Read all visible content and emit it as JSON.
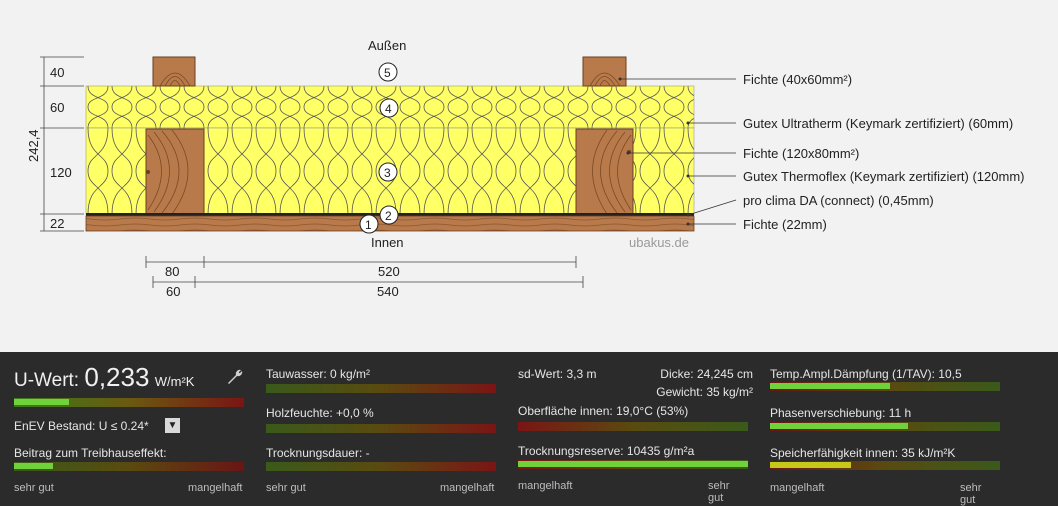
{
  "diagram": {
    "outside_label": "Außen",
    "inside_label": "Innen",
    "watermark": "ubakus.de",
    "total_thickness": "242,4",
    "left_dims": [
      "40",
      "60",
      "120",
      "22"
    ],
    "layer_numbers": [
      "5",
      "4",
      "3",
      "2",
      "1"
    ],
    "callouts": [
      "Fichte (40x60mm²)",
      "Gutex Ultratherm (Keymark zertifiziert) (60mm)",
      "Fichte (120x80mm²)",
      "Gutex Thermoflex (Keymark zertifiziert) (120mm)",
      "pro clima DA (connect) (0,45mm)",
      "Fichte (22mm)"
    ],
    "dims_top": [
      "80",
      "520"
    ],
    "dims_bottom": [
      "60",
      "540"
    ],
    "colors": {
      "insulation": "#ffff66",
      "wood": "#b87a4b",
      "membrane": "#222222"
    }
  },
  "panel": {
    "uwert": {
      "label": "U-Wert:",
      "value": "0,233",
      "unit": "W/m²K",
      "fill": 0.24,
      "icon": "wrench-icon"
    },
    "enev": {
      "label": "EnEV Bestand: U ≤ 0.24*",
      "dropdown_icon": "▼"
    },
    "treibhaus": {
      "label": "Beitrag zum Treibhauseffekt:",
      "fill": 0.17
    },
    "tauwasser": {
      "label": "Tauwasser: 0 kg/m²",
      "fill": 0.0
    },
    "holzfeuchte": {
      "label": "Holzfeuchte: +0,0 %",
      "fill": 0.0
    },
    "trocknungsdauer": {
      "label": "Trocknungsdauer: -",
      "fill": 0.0
    },
    "sdwert": {
      "label": "sd-Wert: 3,3 m"
    },
    "dicke": {
      "label": "Dicke: 24,245 cm"
    },
    "gewicht": {
      "label": "Gewicht: 35 kg/m²"
    },
    "oberflaeche": {
      "label": "Oberfläche innen: 19,0°C (53%)",
      "fill": 0.0
    },
    "trocknungsreserve": {
      "label": "Trocknungsreserve: 10435 g/m²a",
      "fill": 1.0
    },
    "temp_amp": {
      "label": "Temp.Ampl.Dämpfung (1/TAV): 10,5",
      "fill": 0.52
    },
    "phasen": {
      "label": "Phasenverschiebung: 11 h",
      "fill": 0.6
    },
    "speicher": {
      "label": "Speicherfähigkeit innen: 35 kJ/m²K",
      "fill": 0.35
    },
    "scales": {
      "good": "sehr gut",
      "bad": "mangelhaft"
    }
  }
}
